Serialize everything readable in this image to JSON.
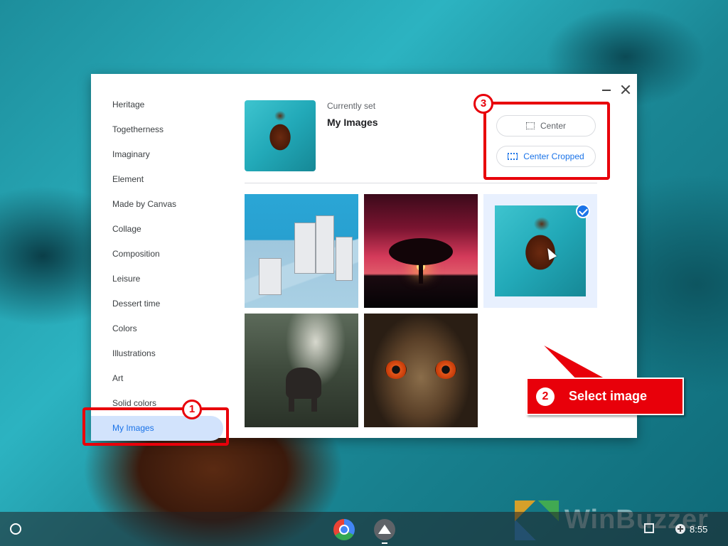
{
  "dialog": {
    "sidebar": {
      "items": [
        {
          "label": "Heritage"
        },
        {
          "label": "Togetherness"
        },
        {
          "label": "Imaginary"
        },
        {
          "label": "Element"
        },
        {
          "label": "Made by Canvas"
        },
        {
          "label": "Collage"
        },
        {
          "label": "Composition"
        },
        {
          "label": "Leisure"
        },
        {
          "label": "Dessert time"
        },
        {
          "label": "Colors"
        },
        {
          "label": "Illustrations"
        },
        {
          "label": "Art"
        },
        {
          "label": "Solid colors"
        },
        {
          "label": "My Images",
          "active": true
        }
      ]
    },
    "current": {
      "label": "Currently set",
      "name": "My Images"
    },
    "layout_options": {
      "center": "Center",
      "center_cropped": "Center Cropped"
    },
    "images": [
      {
        "name": "city-illustration"
      },
      {
        "name": "tree-sunset"
      },
      {
        "name": "sea-turtle",
        "selected": true
      },
      {
        "name": "elephant-forest"
      },
      {
        "name": "owl-closeup"
      }
    ]
  },
  "annotations": {
    "step1": "1",
    "step2": "2",
    "step3": "3",
    "callout_text": "Select image",
    "color": "#e8000a"
  },
  "shelf": {
    "time": "8:55"
  },
  "watermark": "WinBuzzer"
}
